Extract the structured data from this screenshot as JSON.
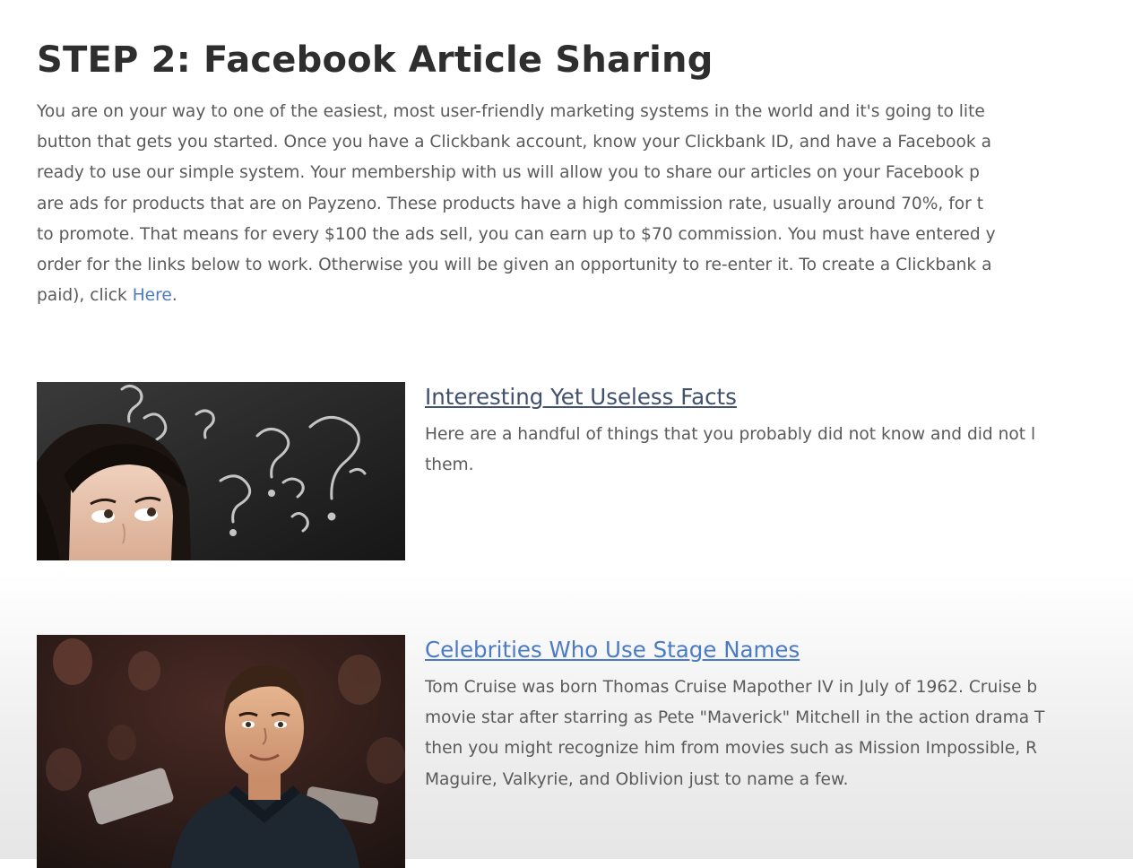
{
  "heading": "STEP 2: Facebook Article Sharing",
  "intro": {
    "lines": [
      "You are on your way to one of the easiest, most user-friendly marketing systems in the world and it's going to lite",
      "button that gets you started. Once you have a Clickbank account, know your Clickbank ID, and have a Facebook a",
      "ready to use our simple system. Your membership with us will allow you to share our articles on your Facebook p",
      "are ads for products that are on Payzeno. These products have a high commission rate, usually around 70%, for t",
      "to promote. That means for every $100 the ads sell, you can earn up to $70 commission. You must have entered y",
      "order for the links below to work. Otherwise you will be given an opportunity to re-enter it. To create a Clickbank a"
    ],
    "last_line_prefix": "paid), click ",
    "link_text": "Here",
    "last_line_suffix": "."
  },
  "articles": [
    {
      "title": "Interesting Yet Useless Facts",
      "excerpt_lines": [
        "Here are a handful of things that you probably did not know and did not l",
        "them."
      ]
    },
    {
      "title": "Celebrities Who Use Stage Names",
      "excerpt_lines": [
        "Tom Cruise was born Thomas Cruise Mapother IV in July of 1962. Cruise b",
        "movie star after starring as Pete \"Maverick\" Mitchell in the action drama T",
        "then you might recognize him from movies such as Mission Impossible, R",
        "Maguire, Valkyrie, and Oblivion just to name a few."
      ]
    }
  ],
  "colors": {
    "heading": "#2e2e2e",
    "body_text": "#5a5a5a",
    "link": "#4a7bc4",
    "visited_link": "#41506e"
  }
}
